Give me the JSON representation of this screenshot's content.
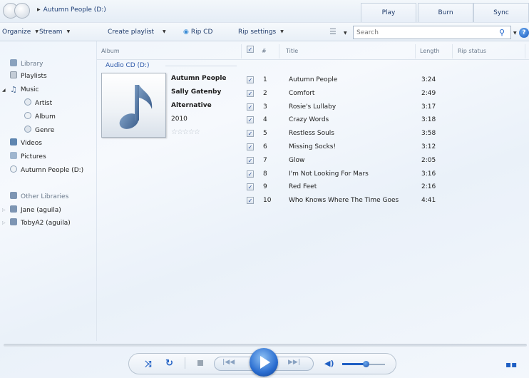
{
  "titlebar": {
    "breadcrumb": "Autumn People (D:)"
  },
  "tabs": [
    {
      "label": "Play"
    },
    {
      "label": "Burn"
    },
    {
      "label": "Sync"
    }
  ],
  "toolbar": {
    "organize": "Organize",
    "stream": "Stream",
    "create_playlist": "Create playlist",
    "rip_cd": "Rip CD",
    "rip_settings": "Rip settings",
    "search_placeholder": "Search",
    "help": "?"
  },
  "nav": {
    "library": "Library",
    "playlists": "Playlists",
    "music": "Music",
    "artist": "Artist",
    "album": "Album",
    "genre": "Genre",
    "videos": "Videos",
    "pictures": "Pictures",
    "cd": "Autumn People (D:)",
    "other_libraries": "Other Libraries",
    "jane": "Jane (aguila)",
    "toby": "TobyA2 (aguila)"
  },
  "columns": {
    "album": "Album",
    "num": "#",
    "title": "Title",
    "length": "Length",
    "rip_status": "Rip status"
  },
  "group": {
    "label": "Audio CD (D:)"
  },
  "album": {
    "title": "Autumn People",
    "artist": "Sally Gatenby",
    "genre": "Alternative",
    "year": "2010",
    "rating_stars": 0,
    "rating_glyphs": "☆☆☆☆☆"
  },
  "tracks": [
    {
      "num": "1",
      "title": "Autumn People",
      "length": "3:24",
      "checked": true
    },
    {
      "num": "2",
      "title": "Comfort",
      "length": "2:49",
      "checked": true
    },
    {
      "num": "3",
      "title": "Rosie's Lullaby",
      "length": "3:17",
      "checked": true
    },
    {
      "num": "4",
      "title": "Crazy Words",
      "length": "3:18",
      "checked": true
    },
    {
      "num": "5",
      "title": "Restless Souls",
      "length": "3:58",
      "checked": true
    },
    {
      "num": "6",
      "title": "Missing Socks!",
      "length": "3:12",
      "checked": true
    },
    {
      "num": "7",
      "title": "Glow",
      "length": "2:05",
      "checked": true
    },
    {
      "num": "8",
      "title": "I'm Not Looking For Mars",
      "length": "3:16",
      "checked": true
    },
    {
      "num": "9",
      "title": "Red Feet",
      "length": "2:16",
      "checked": true
    },
    {
      "num": "10",
      "title": "Who Knows Where The Time Goes",
      "length": "4:41",
      "checked": true
    }
  ],
  "player": {
    "volume_fraction": 0.55,
    "check_glyph": "✓"
  }
}
